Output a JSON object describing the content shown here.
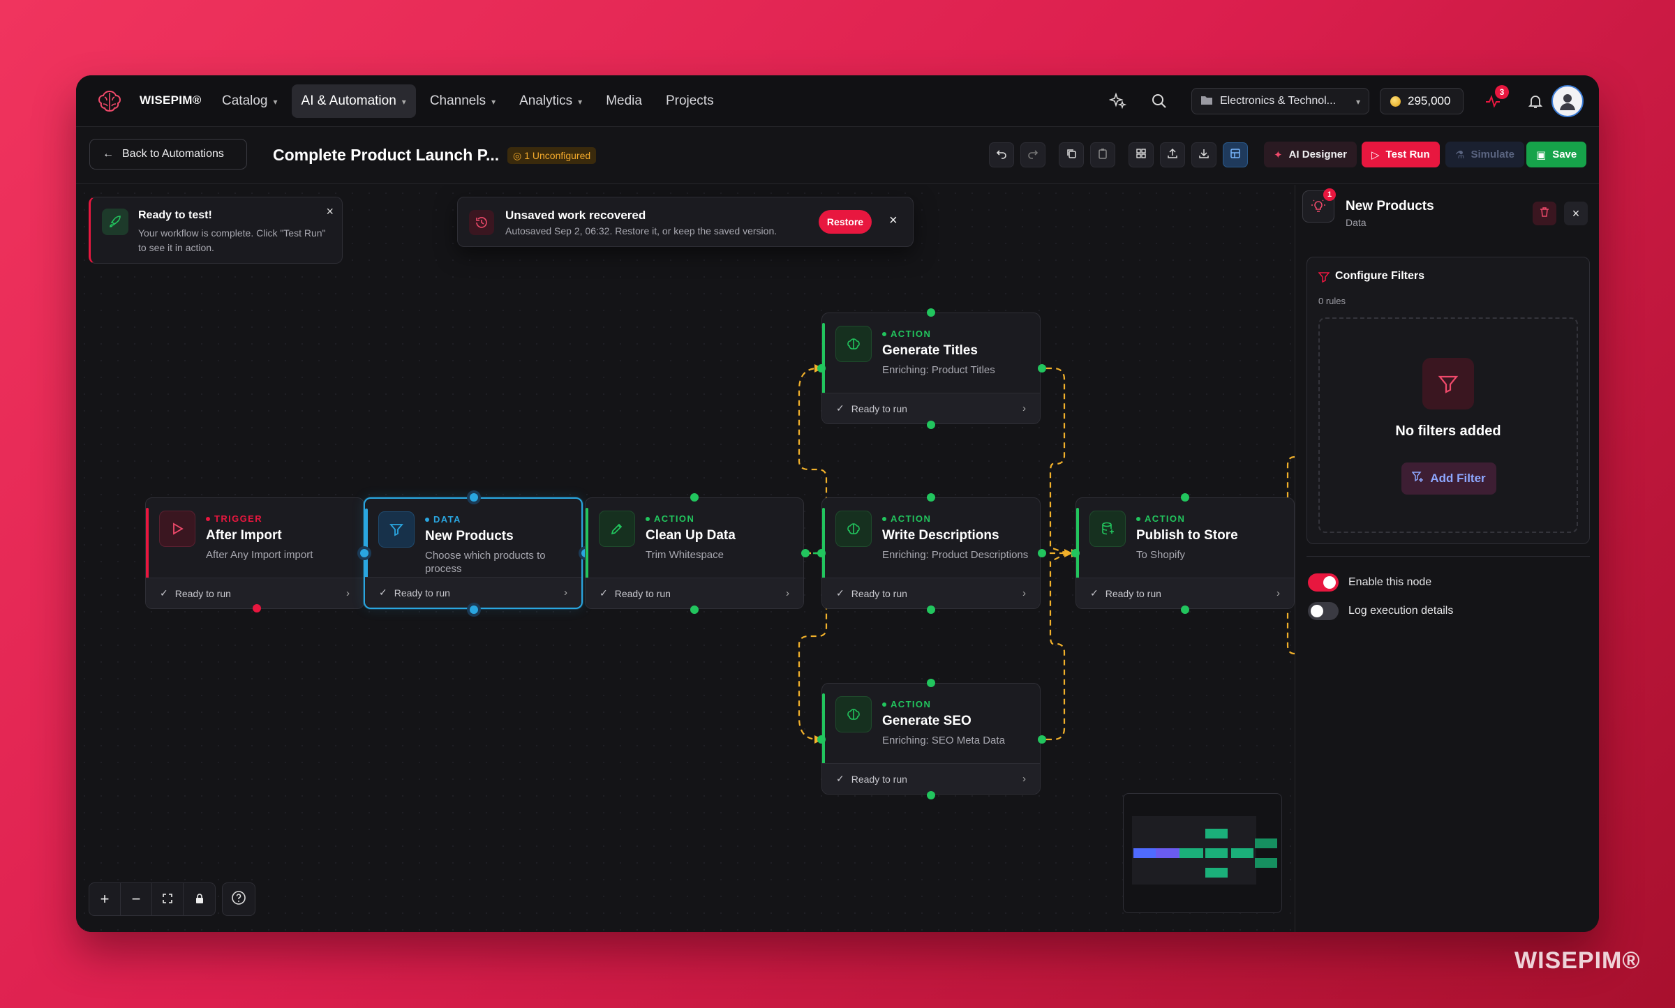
{
  "app": {
    "brand": "WISEPIM®"
  },
  "nav": {
    "items": [
      "Catalog",
      "AI & Automation",
      "Channels",
      "Analytics",
      "Media",
      "Projects"
    ],
    "active": "AI & Automation"
  },
  "topbar": {
    "workspace": "Electronics & Technol...",
    "credits": "295,000",
    "notification_count": "3"
  },
  "subbar": {
    "back_label": "Back to Automations",
    "workflow_title": "Complete Product Launch P...",
    "unconfigured": "1 Unconfigured",
    "ai_designer": "AI Designer",
    "test_run": "Test Run",
    "simulate": "Simulate",
    "save": "Save"
  },
  "toast": {
    "title": "Ready to test!",
    "message": "Your workflow is complete. Click \"Test Run\" to see it in action."
  },
  "recovery": {
    "title": "Unsaved work recovered",
    "message": "Autosaved Sep 2, 06:32. Restore it, or keep the saved version.",
    "restore_label": "Restore"
  },
  "nodes": [
    {
      "type": "TRIGGER",
      "name": "After Import",
      "sub": "After Any Import import",
      "status": "Ready to run"
    },
    {
      "type": "DATA",
      "name": "New Products",
      "sub": "Choose which products to process",
      "status": "Ready to run"
    },
    {
      "type": "ACTION",
      "name": "Clean Up Data",
      "sub": "Trim Whitespace",
      "status": "Ready to run"
    },
    {
      "type": "ACTION",
      "name": "Generate Titles",
      "sub": "Enriching: Product Titles",
      "status": "Ready to run"
    },
    {
      "type": "ACTION",
      "name": "Write Descriptions",
      "sub": "Enriching: Product Descriptions",
      "status": "Ready to run"
    },
    {
      "type": "ACTION",
      "name": "Generate SEO",
      "sub": "Enriching: SEO Meta Data",
      "status": "Ready to run"
    },
    {
      "type": "ACTION",
      "name": "Publish to Store",
      "sub": "To Shopify",
      "status": "Ready to run"
    }
  ],
  "panel": {
    "badge": "1",
    "title": "New Products",
    "subtitle": "Data",
    "section_title": "Configure Filters",
    "rules_count": "0 rules",
    "empty_title": "No filters added",
    "add_filter": "Add Filter",
    "enable_label": "Enable this node",
    "log_label": "Log execution details",
    "enable_on": true,
    "log_on": false
  },
  "colors": {
    "accent": "#e8173f",
    "action": "#22c55e",
    "data": "#2aa6e0",
    "edge": "#f2b12b"
  },
  "watermark": "WISEPIM®"
}
